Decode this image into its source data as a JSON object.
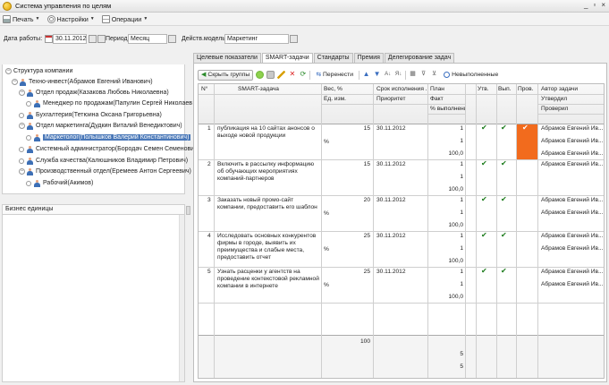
{
  "window": {
    "title": "Система управления по целям",
    "controls": [
      "_",
      "▫",
      "×"
    ]
  },
  "toolbar": {
    "print": "Печать",
    "settings": "Настройки",
    "operations": "Операции"
  },
  "filters": {
    "work_date_label": "Дата работы:",
    "work_date_value": "30.11.2012",
    "period_label": "Период:",
    "period_value": "Месяц",
    "model_label": "Действ.модель:",
    "model_value": "Маркетинг"
  },
  "tree": {
    "header": "Структура компании",
    "rows": [
      {
        "label": "Структура компании",
        "level": 0,
        "kind": "root"
      },
      {
        "label": "Техно-инвест(Абрамов Евгений Иванович)",
        "level": 1,
        "kind": "person"
      },
      {
        "label": "Отдел продаж(Казакова Любовь Николаевна)",
        "level": 2,
        "kind": "person"
      },
      {
        "label": "Менеджер по продажам(Папулин Сергей Николаев",
        "level": 3,
        "kind": "leaf"
      },
      {
        "label": "Бухгалтерия(Тетюина Оксана Григорьевна)",
        "level": 2,
        "kind": "person"
      },
      {
        "label": "Отдел маркетинга(Дудкин Виталий Венедиктович)",
        "level": 2,
        "kind": "person"
      },
      {
        "label": "Маркетолог(Полышков Валерий Константинович)",
        "level": 3,
        "kind": "leaf",
        "selected": true
      },
      {
        "label": "Системный администратор(Бородач Семен Семенович)",
        "level": 2,
        "kind": "person"
      },
      {
        "label": "Служба качества(Калюшников Владимир Петрович)",
        "level": 2,
        "kind": "person"
      },
      {
        "label": "Производственный отдел(Еремеев Антон Сергеевич)",
        "level": 2,
        "kind": "person"
      },
      {
        "label": "Рабочий(Акимов)",
        "level": 3,
        "kind": "person"
      }
    ]
  },
  "business_units": {
    "header": "Бизнес единицы"
  },
  "tabs": [
    "Целевые показатели",
    "SMART-задачи",
    "Стандарты",
    "Премия",
    "Делегирование задач"
  ],
  "active_tab": 1,
  "panel_toolbar": {
    "hide_groups": "Скрыть группы",
    "move": "Перенести",
    "unviewed": "Невыполненные"
  },
  "grid": {
    "headers": {
      "no": "N°",
      "task": "SMART-задача",
      "weight": "Вес, %",
      "unit": "Ед. изм.",
      "deadline": "Срок исполнения ...",
      "priority": "Приоритет",
      "plan": "План",
      "fact": "Факт",
      "pct": "% выполнения",
      "approved": "Утв.",
      "done": "Вып.",
      "checked": "Пров.",
      "author": "Автор задачи",
      "approved_by": "Утвердил",
      "checked_by": "Проверил"
    },
    "rows": [
      {
        "no": "1",
        "task": "публикация на 10 сайтах анонсов о выходе новой продукции",
        "weight": "15",
        "unit": "%",
        "deadline": "30.11.2012",
        "plan": "1",
        "fact": "1",
        "pct": "100,0",
        "approved": true,
        "done": true,
        "checked": true,
        "highlight": true,
        "author": "Абрамов Евгений Ив...",
        "approved_by": "Абрамов Евгений Ив...",
        "checked_by": "Абрамов Евгений Ив..."
      },
      {
        "no": "2",
        "task": "Включить в рассылку информацию об обучающих мероприятиях компаний-партнеров",
        "weight": "15",
        "unit": "",
        "deadline": "30.11.2012",
        "plan": "1",
        "fact": "1",
        "pct": "100,0",
        "approved": true,
        "done": true,
        "checked": false,
        "highlight": false,
        "author": "Абрамов Евгений Ив...",
        "approved_by": "",
        "checked_by": ""
      },
      {
        "no": "3",
        "task": "Заказать новый промо-сайт компании, предоставить его шаблон",
        "weight": "20",
        "unit": "%",
        "deadline": "30.11.2012",
        "plan": "1",
        "fact": "1",
        "pct": "100,0",
        "approved": true,
        "done": true,
        "checked": false,
        "highlight": false,
        "author": "Абрамов Евгений Ив...",
        "approved_by": "Абрамов Евгений Ив...",
        "checked_by": ""
      },
      {
        "no": "4",
        "task": "Исследовать основных конкурентов фирмы в городе, выявить их преимущества и слабые места, предоставить отчет",
        "weight": "25",
        "unit": "%",
        "deadline": "30.11.2012",
        "plan": "1",
        "fact": "1",
        "pct": "100,0",
        "approved": true,
        "done": true,
        "checked": false,
        "highlight": false,
        "author": "Абрамов Евгений Ив...",
        "approved_by": "Абрамов Евгений Ив...",
        "checked_by": ""
      },
      {
        "no": "5",
        "task": "Узнать расценки у агентств на проведение контекстовой рекламной компании в интернете",
        "weight": "25",
        "unit": "%",
        "deadline": "30.11.2012",
        "plan": "1",
        "fact": "1",
        "pct": "100,0",
        "approved": true,
        "done": true,
        "checked": false,
        "highlight": false,
        "author": "Абрамов Евгений Ив...",
        "approved_by": "Абрамов Евгений Ив...",
        "checked_by": ""
      }
    ],
    "totals": {
      "weight": "100",
      "plan": "5",
      "fact": "5"
    }
  },
  "colors": {
    "accent": "#f26b1d",
    "selection": "#4a78b8",
    "check": "#1a7a1a"
  }
}
